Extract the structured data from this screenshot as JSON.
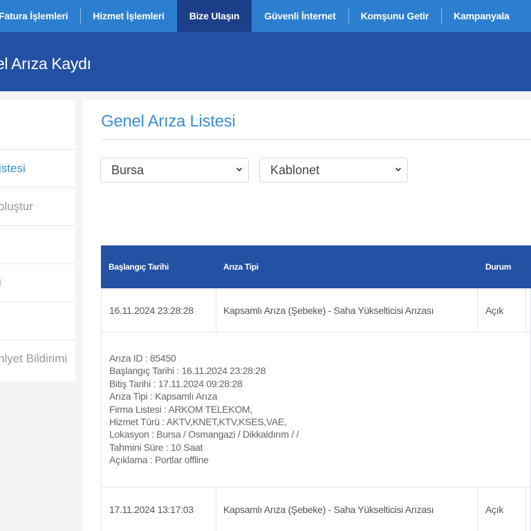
{
  "nav": {
    "items": [
      "Fatura İşlemleri",
      "Hizmet İşlemleri",
      "Bize Ulaşın",
      "Güvenli İnternet",
      "Komşunu Getir",
      "Kampanyala"
    ],
    "active_index": 2
  },
  "banner": {
    "title": "el Arıza Kaydı"
  },
  "sidebar": {
    "items": [
      {
        "label": ""
      },
      {
        "label": "istesi"
      },
      {
        "label": "oluştur"
      },
      {
        "label": ""
      },
      {
        "label": "i"
      },
      {
        "label": ""
      },
      {
        "label": "nlyet Bildirimi"
      }
    ],
    "active_index": 1
  },
  "main": {
    "title": "Genel Arıza Listesi",
    "filters": {
      "city": "Bursa",
      "provider": "Kablonet"
    },
    "table": {
      "headers": [
        "Başlangıç Tarihi",
        "Arıza Tipi",
        "Durum"
      ],
      "rows": [
        {
          "date": "16.11.2024 23:28:28",
          "type": "Kapsamlı Arıza (Şebeke) - Saha Yükselticisi Arızası",
          "status": "Açık"
        },
        {
          "date": "17.11.2024 13:17:03",
          "type": "Kapsamlı Arıza (Şebeke) - Saha Yükselticisi Arızası",
          "status": "Açık"
        }
      ],
      "details": [
        "Arıza ID : 85450",
        "Başlangıç Tarihi : 16.11.2024 23:28:28",
        "Bitiş Tarihi : 17.11.2024 09:28:28",
        "Arıza Tipi : Kapsamlı Arıza",
        "Firma Listesi : ARKOM TELEKOM,",
        "Hizmet Türü : AKTV,KNET,KTV,KSES,VAE,",
        "Lokasyon : Bursa / Osmangazi / Dikkaldırım / /",
        "Tahmini Süre : 10 Saat",
        "Açıklama : Portlar offline"
      ]
    }
  },
  "colors": {
    "nav": "#2c7fd0",
    "nav_active": "#1d3f8a",
    "banner": "#2351a3",
    "accent": "#3d8fcf",
    "table_header": "#2351a3"
  },
  "icons": {
    "select_chevron": "chevron-down-icon"
  }
}
